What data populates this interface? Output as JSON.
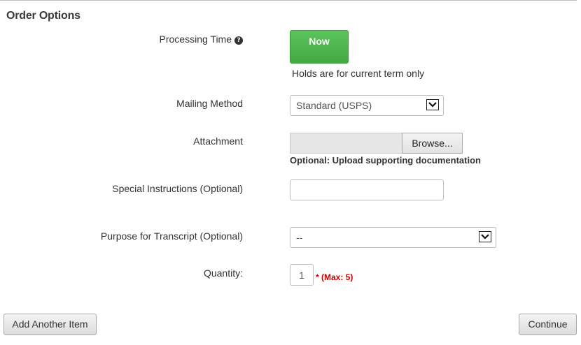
{
  "section": {
    "title": "Order Options"
  },
  "processing_time": {
    "label": "Processing Time",
    "help_glyph": "?",
    "button_label": "Now",
    "note": "Holds are for current term only"
  },
  "mailing_method": {
    "label": "Mailing Method",
    "selected": "Standard (USPS)"
  },
  "attachment": {
    "label": "Attachment",
    "browse_label": "Browse...",
    "note": "Optional: Upload supporting documentation"
  },
  "special_instructions": {
    "label": "Special Instructions (Optional)",
    "value": ""
  },
  "purpose": {
    "label": "Purpose for Transcript (Optional)",
    "selected": "--"
  },
  "quantity": {
    "label": "Quantity:",
    "value": "1",
    "max_note": "* (Max: 5)"
  },
  "actions": {
    "add_item_label": "Add Another Item",
    "continue_label": "Continue"
  },
  "colors": {
    "primary_green": "#4cb84c",
    "required_red": "#cc0000"
  }
}
